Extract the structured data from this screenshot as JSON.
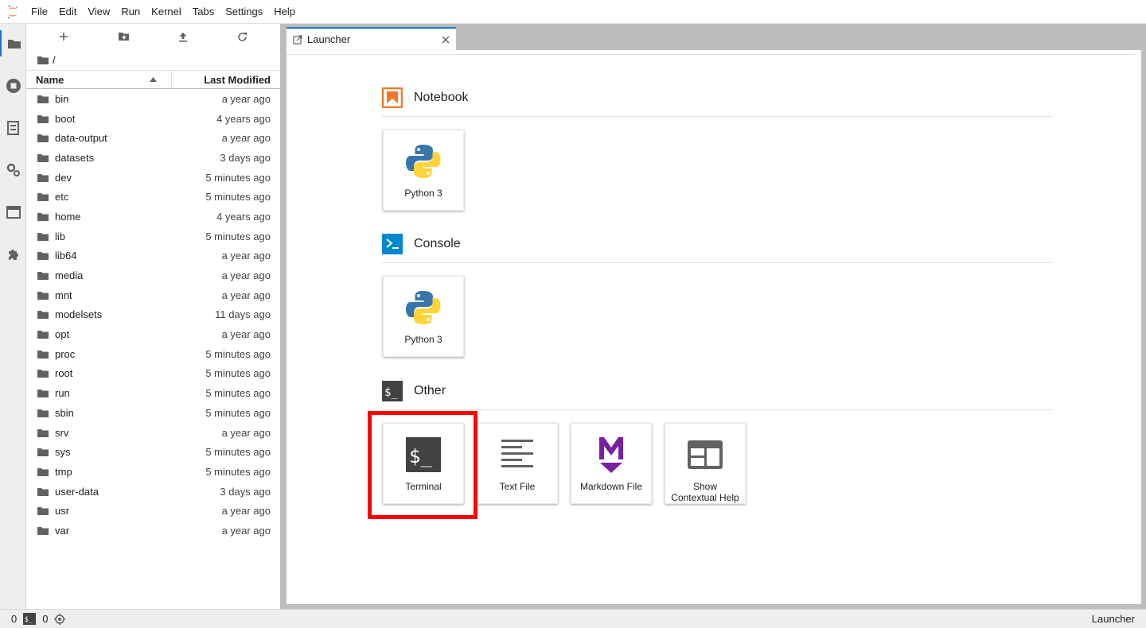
{
  "menu": [
    "File",
    "Edit",
    "View",
    "Run",
    "Kernel",
    "Tabs",
    "Settings",
    "Help"
  ],
  "filebrowser": {
    "breadcrumb": "/",
    "columns": {
      "name": "Name",
      "modified": "Last Modified"
    },
    "files": [
      {
        "name": "bin",
        "modified": "a year ago"
      },
      {
        "name": "boot",
        "modified": "4 years ago"
      },
      {
        "name": "data-output",
        "modified": "a year ago"
      },
      {
        "name": "datasets",
        "modified": "3 days ago"
      },
      {
        "name": "dev",
        "modified": "5 minutes ago"
      },
      {
        "name": "etc",
        "modified": "5 minutes ago"
      },
      {
        "name": "home",
        "modified": "4 years ago"
      },
      {
        "name": "lib",
        "modified": "5 minutes ago"
      },
      {
        "name": "lib64",
        "modified": "a year ago"
      },
      {
        "name": "media",
        "modified": "a year ago"
      },
      {
        "name": "mnt",
        "modified": "a year ago"
      },
      {
        "name": "modelsets",
        "modified": "11 days ago"
      },
      {
        "name": "opt",
        "modified": "a year ago"
      },
      {
        "name": "proc",
        "modified": "5 minutes ago"
      },
      {
        "name": "root",
        "modified": "5 minutes ago"
      },
      {
        "name": "run",
        "modified": "5 minutes ago"
      },
      {
        "name": "sbin",
        "modified": "5 minutes ago"
      },
      {
        "name": "srv",
        "modified": "a year ago"
      },
      {
        "name": "sys",
        "modified": "5 minutes ago"
      },
      {
        "name": "tmp",
        "modified": "5 minutes ago"
      },
      {
        "name": "user-data",
        "modified": "3 days ago"
      },
      {
        "name": "usr",
        "modified": "a year ago"
      },
      {
        "name": "var",
        "modified": "a year ago"
      }
    ]
  },
  "tab": {
    "label": "Launcher"
  },
  "launcher": {
    "notebook": {
      "title": "Notebook",
      "cards": [
        "Python 3"
      ]
    },
    "console": {
      "title": "Console",
      "cards": [
        "Python 3"
      ]
    },
    "other": {
      "title": "Other",
      "terminal": "Terminal",
      "textfile": "Text File",
      "markdown": "Markdown File",
      "help_line1": "Show",
      "help_line2": "Contextual Help"
    }
  },
  "statusbar": {
    "kernels": "0",
    "terminals": "0",
    "right": "Launcher"
  },
  "colors": {
    "accent": "#1976d2",
    "notebook_icon": "#f37726",
    "console_icon": "#0288d1",
    "markdown_icon": "#7b1fa2",
    "highlight": "#ff0000"
  }
}
